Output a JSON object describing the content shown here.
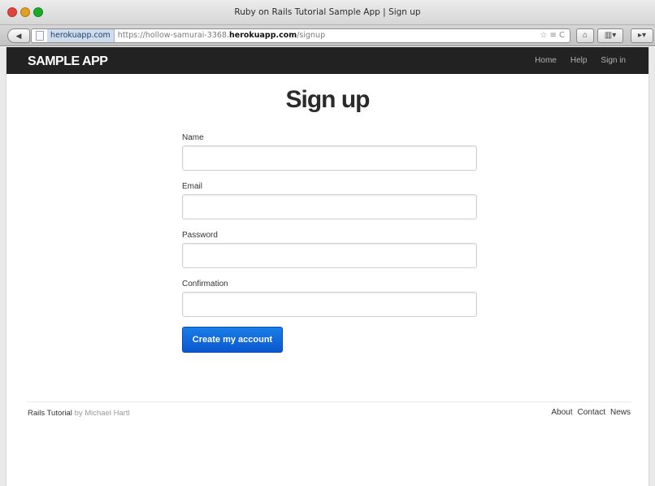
{
  "window": {
    "title": "Ruby on Rails Tutorial Sample App | Sign up"
  },
  "browser": {
    "back_glyph": "◀",
    "domain_badge": "herokuapp.com",
    "url_prefix": "https://hollow-samurai-3368.",
    "url_host": "herokuapp.com",
    "url_path": "/signup",
    "url_right_glyphs": "☆ ≡ C",
    "home_glyph": "⌂",
    "bookmarks_glyph": "▥▾",
    "extra_glyph": "▸▾"
  },
  "navbar": {
    "brand": "SAMPLE APP",
    "links": [
      "Home",
      "Help",
      "Sign in"
    ]
  },
  "signup": {
    "heading": "Sign up",
    "fields": [
      {
        "label": "Name",
        "value": ""
      },
      {
        "label": "Email",
        "value": ""
      },
      {
        "label": "Password",
        "value": ""
      },
      {
        "label": "Confirmation",
        "value": ""
      }
    ],
    "submit_label": "Create my account"
  },
  "footer": {
    "site": "Rails Tutorial",
    "by": "by",
    "author": "Michael Hartl",
    "links": [
      "About",
      "Contact",
      "News"
    ]
  },
  "colors": {
    "navbar_bg": "#222222",
    "button_blue": "#0a58cf"
  }
}
